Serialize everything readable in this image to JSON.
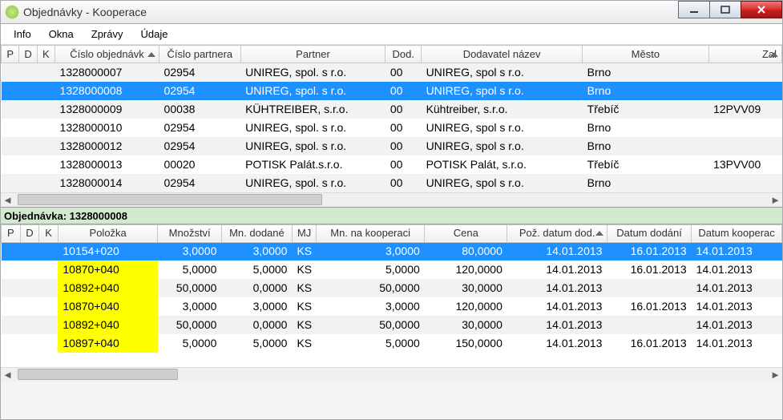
{
  "window": {
    "title": "Objednávky - Kooperace"
  },
  "menu": {
    "items": [
      "Info",
      "Okna",
      "Zprávy",
      "Údaje"
    ]
  },
  "top_grid": {
    "columns": [
      "P",
      "D",
      "K",
      "Číslo objednávk",
      "Číslo partnera",
      "Partner",
      "Dod.",
      "Dodavatel název",
      "Město",
      "Zal"
    ],
    "sort_col": 3,
    "selected_index": 1,
    "rows": [
      {
        "p": "",
        "d": "",
        "k": "",
        "cislo_obj": "1328000007",
        "cislo_part": "02954",
        "partner": "UNIREG, spol. s r.o.",
        "dod": "00",
        "dodavatel": "UNIREG, spol s r.o.",
        "mesto": "Brno",
        "zal": ""
      },
      {
        "p": "",
        "d": "",
        "k": "",
        "cislo_obj": "1328000008",
        "cislo_part": "02954",
        "partner": "UNIREG, spol. s r.o.",
        "dod": "00",
        "dodavatel": "UNIREG, spol s r.o.",
        "mesto": "Brno",
        "zal": ""
      },
      {
        "p": "",
        "d": "",
        "k": "",
        "cislo_obj": "1328000009",
        "cislo_part": "00038",
        "partner": "KÜHTREIBER, s.r.o.",
        "dod": "00",
        "dodavatel": "Kühtreiber, s.r.o.",
        "mesto": "Třebíč",
        "zal": "12PVV09"
      },
      {
        "p": "",
        "d": "",
        "k": "",
        "cislo_obj": "1328000010",
        "cislo_part": "02954",
        "partner": "UNIREG, spol. s r.o.",
        "dod": "00",
        "dodavatel": "UNIREG, spol s r.o.",
        "mesto": "Brno",
        "zal": ""
      },
      {
        "p": "",
        "d": "",
        "k": "",
        "cislo_obj": "1328000012",
        "cislo_part": "02954",
        "partner": "UNIREG, spol. s r.o.",
        "dod": "00",
        "dodavatel": "UNIREG, spol s r.o.",
        "mesto": "Brno",
        "zal": ""
      },
      {
        "p": "",
        "d": "",
        "k": "",
        "cislo_obj": "1328000013",
        "cislo_part": "00020",
        "partner": "POTISK Palát.s.r.o.",
        "dod": "00",
        "dodavatel": "POTISK Palát, s.r.o.",
        "mesto": "Třebíč",
        "zal": "13PVV00"
      },
      {
        "p": "",
        "d": "",
        "k": "",
        "cislo_obj": "1328000014",
        "cislo_part": "02954",
        "partner": "UNIREG, spol. s r.o.",
        "dod": "00",
        "dodavatel": "UNIREG, spol s r.o.",
        "mesto": "Brno",
        "zal": ""
      }
    ]
  },
  "detail": {
    "title": "Objednávka: 1328000008",
    "columns": [
      "P",
      "D",
      "K",
      "Položka",
      "Množství",
      "Mn. dodané",
      "MJ",
      "Mn. na kooperaci",
      "Cena",
      "Pož. datum dod.",
      "Datum dodání",
      "Datum kooperac"
    ],
    "sort_col": 9,
    "selected_index": 0,
    "rows": [
      {
        "p": "",
        "d": "",
        "k": "",
        "polozka": "10154+020",
        "mnozstvi": "3,0000",
        "mn_dodane": "3,0000",
        "mj": "KS",
        "mn_koop": "3,0000",
        "cena": "80,0000",
        "poz_datum": "14.01.2013",
        "datum_dodani": "16.01.2013",
        "datum_koop": "14.01.2013",
        "yellow": false
      },
      {
        "p": "",
        "d": "",
        "k": "",
        "polozka": "10870+040",
        "mnozstvi": "5,0000",
        "mn_dodane": "5,0000",
        "mj": "KS",
        "mn_koop": "5,0000",
        "cena": "120,0000",
        "poz_datum": "14.01.2013",
        "datum_dodani": "16.01.2013",
        "datum_koop": "14.01.2013",
        "yellow": true
      },
      {
        "p": "",
        "d": "",
        "k": "",
        "polozka": "10892+040",
        "mnozstvi": "50,0000",
        "mn_dodane": "0,0000",
        "mj": "KS",
        "mn_koop": "50,0000",
        "cena": "30,0000",
        "poz_datum": "14.01.2013",
        "datum_dodani": "",
        "datum_koop": "14.01.2013",
        "yellow": true
      },
      {
        "p": "",
        "d": "",
        "k": "",
        "polozka": "10870+040",
        "mnozstvi": "3,0000",
        "mn_dodane": "3,0000",
        "mj": "KS",
        "mn_koop": "3,0000",
        "cena": "120,0000",
        "poz_datum": "14.01.2013",
        "datum_dodani": "16.01.2013",
        "datum_koop": "14.01.2013",
        "yellow": true
      },
      {
        "p": "",
        "d": "",
        "k": "",
        "polozka": "10892+040",
        "mnozstvi": "50,0000",
        "mn_dodane": "0,0000",
        "mj": "KS",
        "mn_koop": "50,0000",
        "cena": "30,0000",
        "poz_datum": "14.01.2013",
        "datum_dodani": "",
        "datum_koop": "14.01.2013",
        "yellow": true
      },
      {
        "p": "",
        "d": "",
        "k": "",
        "polozka": "10897+040",
        "mnozstvi": "5,0000",
        "mn_dodane": "5,0000",
        "mj": "KS",
        "mn_koop": "5,0000",
        "cena": "150,0000",
        "poz_datum": "14.01.2013",
        "datum_dodani": "16.01.2013",
        "datum_koop": "14.01.2013",
        "yellow": true
      }
    ]
  }
}
